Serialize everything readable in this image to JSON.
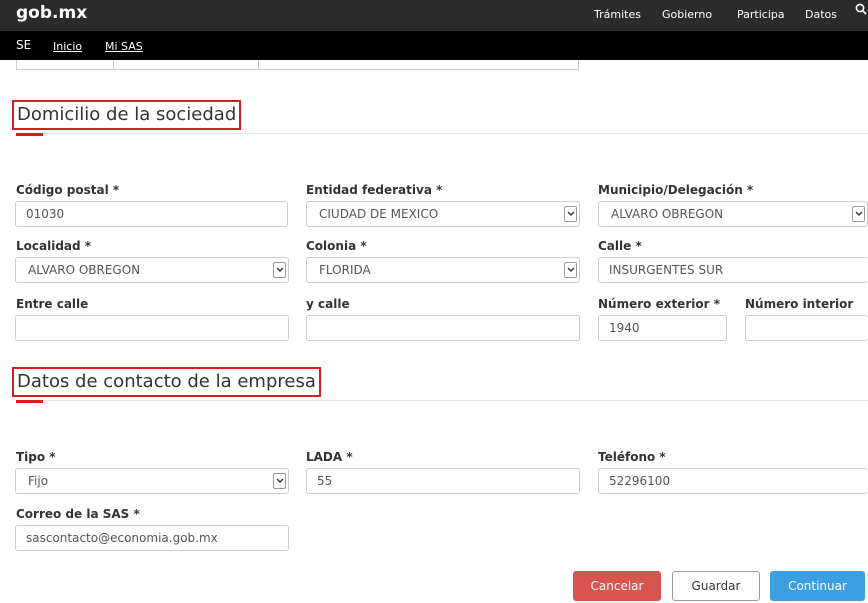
{
  "header": {
    "logo": "gob.mx",
    "nav": [
      "Trámites",
      "Gobierno",
      "Participa",
      "Datos"
    ],
    "sub_title": "SE",
    "sub_links": [
      "Inicio",
      "Mi SAS"
    ]
  },
  "sections": {
    "domicilio_title": "Domicilio de la sociedad",
    "contacto_title": "Datos de contacto de la empresa"
  },
  "domicilio": {
    "codigo_postal": {
      "label": "Código postal *",
      "value": "01030"
    },
    "entidad": {
      "label": "Entidad federativa *",
      "value": "CIUDAD DE MEXICO"
    },
    "municipio": {
      "label": "Municipio/Delegación *",
      "value": "ALVARO OBREGON"
    },
    "localidad": {
      "label": "Localidad *",
      "value": "ALVARO OBREGON"
    },
    "colonia": {
      "label": "Colonia *",
      "value": "FLORIDA"
    },
    "calle": {
      "label": "Calle *",
      "value": "INSURGENTES SUR"
    },
    "entre_calle": {
      "label": "Entre calle",
      "value": ""
    },
    "y_calle": {
      "label": "y calle",
      "value": ""
    },
    "numero_exterior": {
      "label": "Número exterior *",
      "value": "1940"
    },
    "numero_interior": {
      "label": "Número interior",
      "value": ""
    }
  },
  "contacto": {
    "tipo": {
      "label": "Tipo *",
      "value": "Fijo"
    },
    "lada": {
      "label": "LADA *",
      "value": "55"
    },
    "telefono": {
      "label": "Teléfono *",
      "value": "52296100"
    },
    "correo": {
      "label": "Correo de la SAS *",
      "value": "sascontacto@economia.gob.mx"
    }
  },
  "actions": {
    "cancel": "Cancelar",
    "save": "Guardar",
    "continue": "Continuar"
  },
  "colors": {
    "topbar": "#2b2b2b",
    "subbar": "#000000",
    "accent_red": "#d22020",
    "cancel": "#d9534f",
    "continue": "#3aa0e2"
  }
}
